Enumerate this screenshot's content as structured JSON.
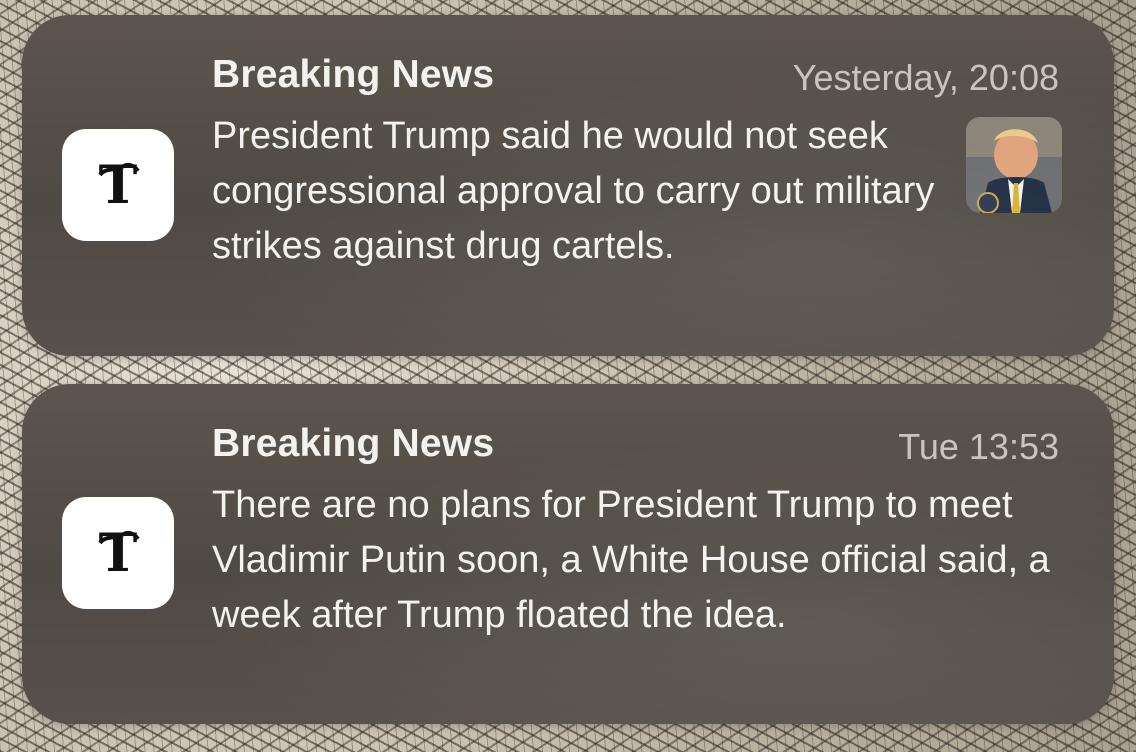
{
  "notifications": [
    {
      "app_icon": "nyt-logo-icon",
      "title": "Breaking News",
      "time": "Yesterday, 20:08",
      "body": "President Trump said he would not seek congressional approval to carry out military strikes against drug cartels.",
      "has_thumbnail": true
    },
    {
      "app_icon": "nyt-logo-icon",
      "title": "Breaking News",
      "time": "Tue 13:53",
      "body": "There are no plans for President Trump to meet Vladimir Putin soon, a White House official said, a week after Trump floated the idea.",
      "has_thumbnail": false
    }
  ],
  "colors": {
    "card_background": "#524c45",
    "title_text": "#f4f2ee",
    "time_text": "#c9c5be",
    "icon_background": "#ffffff"
  }
}
